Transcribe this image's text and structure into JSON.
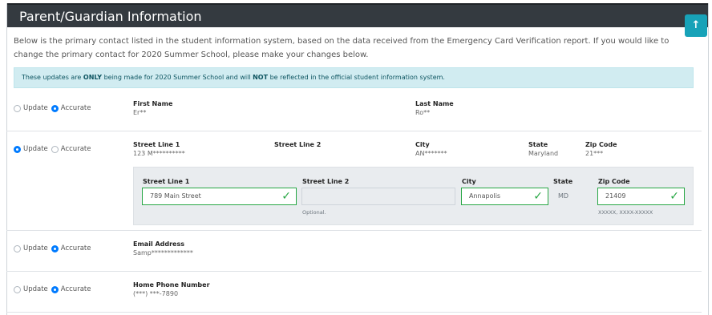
{
  "header": {
    "title": "Parent/Guardian Information"
  },
  "scroll_top": {
    "icon": "arrow-up-icon",
    "glyph": "↑"
  },
  "intro": "Below is the primary contact listed in the student information system, based on the data received from the Emergency Card Verification report. If you would like to change the primary contact for 2020 Summer School, please make your changes below.",
  "alert": {
    "part1": "These updates are ",
    "bold1": "ONLY",
    "part2": " being made for 2020 Summer School and will ",
    "bold2": "NOT",
    "part3": " be reflected in the official student information system."
  },
  "radio_labels": {
    "update": "Update",
    "accurate": "Accurate"
  },
  "name_row": {
    "selected": "accurate",
    "first_name": {
      "label": "First Name",
      "value": "Er**"
    },
    "last_name": {
      "label": "Last Name",
      "value": "Ro**"
    }
  },
  "address_row": {
    "selected": "update",
    "street1": {
      "label": "Street Line 1",
      "value": "123 M**********"
    },
    "street2": {
      "label": "Street Line 2",
      "value": ""
    },
    "city": {
      "label": "City",
      "value": "AN*******"
    },
    "state": {
      "label": "State",
      "value": "Maryland"
    },
    "zip": {
      "label": "Zip Code",
      "value": "21***"
    },
    "edit": {
      "street1": {
        "label": "Street Line 1",
        "value": "789 Main Street"
      },
      "street2": {
        "label": "Street Line 2",
        "value": "",
        "hint": "Optional."
      },
      "city": {
        "label": "City",
        "value": "Annapolis"
      },
      "state": {
        "label": "State",
        "value": "MD"
      },
      "zip": {
        "label": "Zip Code",
        "value": "21409",
        "hint": "XXXXX, XXXX-XXXXX"
      }
    }
  },
  "email_row": {
    "selected": "accurate",
    "label": "Email Address",
    "value": "Samp*************"
  },
  "phone_row": {
    "selected": "accurate",
    "label": "Home Phone Number",
    "value": "(***) ***-7890"
  },
  "colors": {
    "header_bg": "#343a40",
    "accent": "#007bff",
    "valid": "#28a745",
    "alert_bg": "#d1ecf1",
    "scroll_btn": "#17a2b8"
  }
}
